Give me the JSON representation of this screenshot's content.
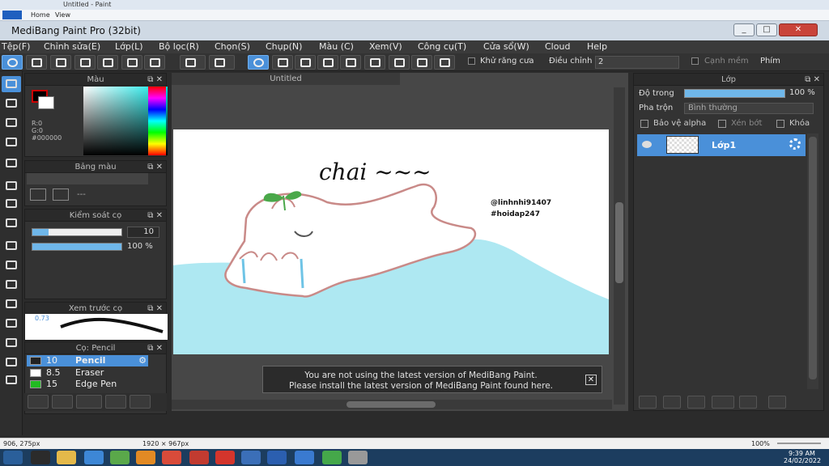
{
  "outer": {
    "title": "Untitled - Paint",
    "tab_home": "Home",
    "tab_view": "View"
  },
  "window": {
    "title": "MediBang Paint Pro (32bit)"
  },
  "menu": [
    "Tệp(F)",
    "Chỉnh sửa(E)",
    "Lớp(L)",
    "Bộ lọc(R)",
    "Chọn(S)",
    "Chụp(N)",
    "Màu (C)",
    "Xem(V)",
    "Công cụ(T)",
    "Cửa sổ(W)",
    "Cloud",
    "Help"
  ],
  "toolbar": {
    "antialias_label": "Khử răng cưa",
    "adjust_label": "Điều chỉnh",
    "adjust_value": "2",
    "smooth_label": "Cạnh mềm",
    "keys_label": "Phím"
  },
  "color_panel": {
    "title": "Màu",
    "r": "R:0",
    "g": "G:0",
    "hex": "#000000"
  },
  "palette_panel": {
    "title": "Bảng màu",
    "placeholder": "---"
  },
  "brush_control": {
    "title": "Kiểm soát cọ",
    "size_value": "10",
    "size_fraction": 0.18,
    "opacity_value": "100 %",
    "opacity_fraction": 1.0
  },
  "brush_preview": {
    "title": "Xem trước cọ",
    "size_text": "0.73"
  },
  "brush_panel": {
    "title": "Cọ: Pencil",
    "brushes": [
      {
        "size": "10",
        "name": "Pencil",
        "color": "#222222"
      },
      {
        "size": "8.5",
        "name": "Eraser",
        "color": "#ffffff"
      },
      {
        "size": "15",
        "name": "Edge Pen",
        "color": "#22bb22"
      }
    ]
  },
  "canvas": {
    "tab": "Untitled",
    "handwritten_text": "chai ~~~",
    "watermark": [
      "@linhnhi91407",
      "#hoidap247"
    ],
    "banner_line1": "You are not using the latest version of MediBang Paint.",
    "banner_line2": "Please install the latest version of MediBang Paint found here."
  },
  "layer_panel": {
    "title": "Lớp",
    "opacity_label": "Độ trong",
    "opacity_value": "100 %",
    "blend_label": "Pha trộn",
    "blend_value": "Bình thường",
    "protect_alpha": "Bảo vệ alpha",
    "clipping": "Xén bớt",
    "lock": "Khóa",
    "layer_name": "Lớp1"
  },
  "status": {
    "coords": "906, 275px",
    "size": "1920 × 967px",
    "zoom": "100%"
  },
  "tray": {
    "time": "9:39 AM",
    "date": "24/02/2022"
  },
  "colors": {
    "accent": "#4a90d9",
    "water": "#aee8f2",
    "outline": "#c98a88",
    "sprout": "#4aa84a"
  }
}
